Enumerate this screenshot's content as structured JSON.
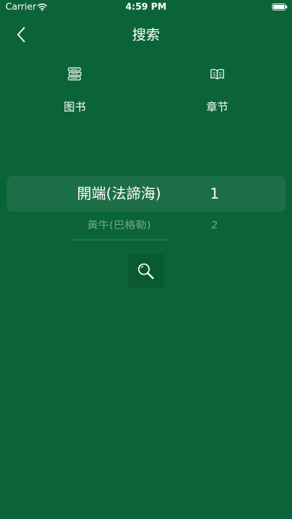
{
  "status_bar": {
    "carrier": "Carrier",
    "time": "4:59 PM"
  },
  "nav": {
    "title": "搜索",
    "back_icon": "chevron-left-icon"
  },
  "mode_tabs": [
    {
      "label": "图书",
      "icon": "books-stack-icon"
    },
    {
      "label": "章节",
      "icon": "open-book-icon"
    }
  ],
  "picker": {
    "selected": {
      "book": "開端(法諦海)",
      "chapter": "1"
    },
    "next": {
      "book": "黃牛(巴格勒)",
      "chapter": "2"
    }
  },
  "search_button": {
    "icon": "magnifier-icon"
  },
  "colors": {
    "background": "#0b6438",
    "text": "#ffffff"
  }
}
